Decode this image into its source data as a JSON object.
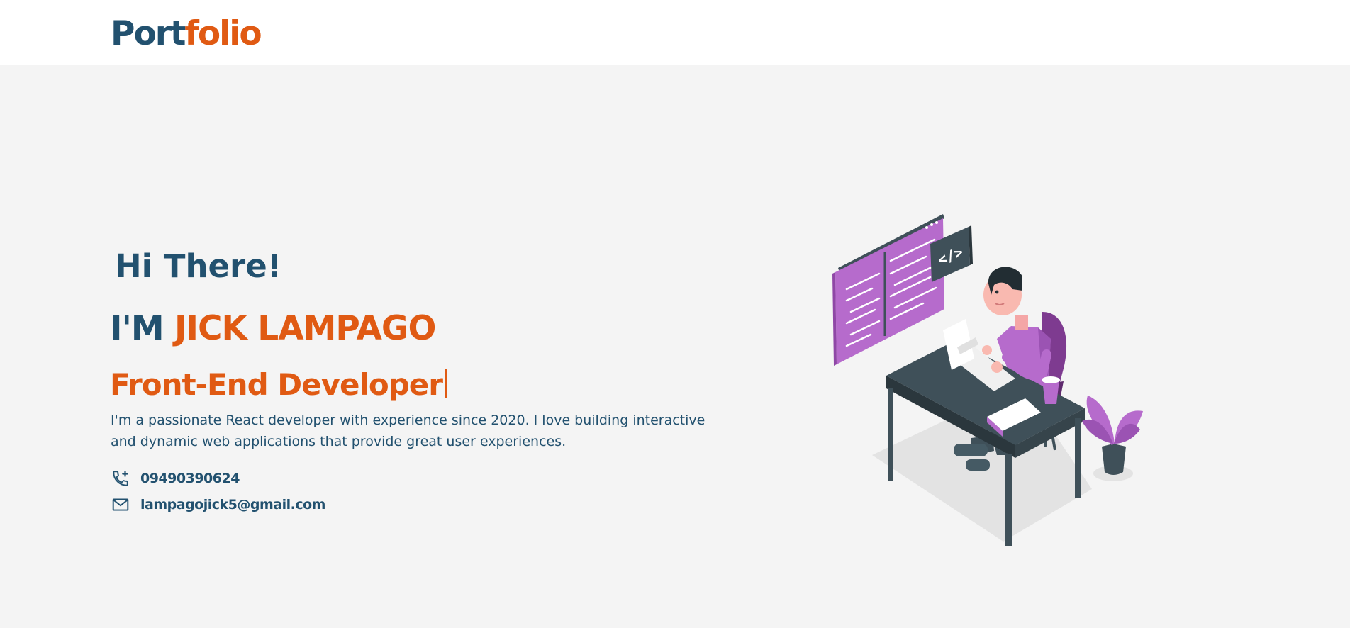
{
  "navbar": {
    "logo_part1": "Port",
    "logo_part2": "folio"
  },
  "hero": {
    "greeting": "Hi There!",
    "intro_prefix": "I'M ",
    "name": "JICK LAMPAGO",
    "role": "Front-End Developer",
    "bio": "I'm a passionate React developer with experience since 2020. I love building interactive and dynamic web applications that provide great user experiences.",
    "phone": "09490390624",
    "email": "lampagojick5@gmail.com",
    "illustration_code_label": "</>"
  },
  "icons": {
    "phone": "phone-add-icon",
    "email": "mail-icon"
  },
  "colors": {
    "primary": "#22516f",
    "accent": "#e05a13",
    "background": "#f4f4f4",
    "navbar": "#ffffff",
    "illustration_purple": "#b66bcc",
    "illustration_dark": "#3f5059"
  }
}
